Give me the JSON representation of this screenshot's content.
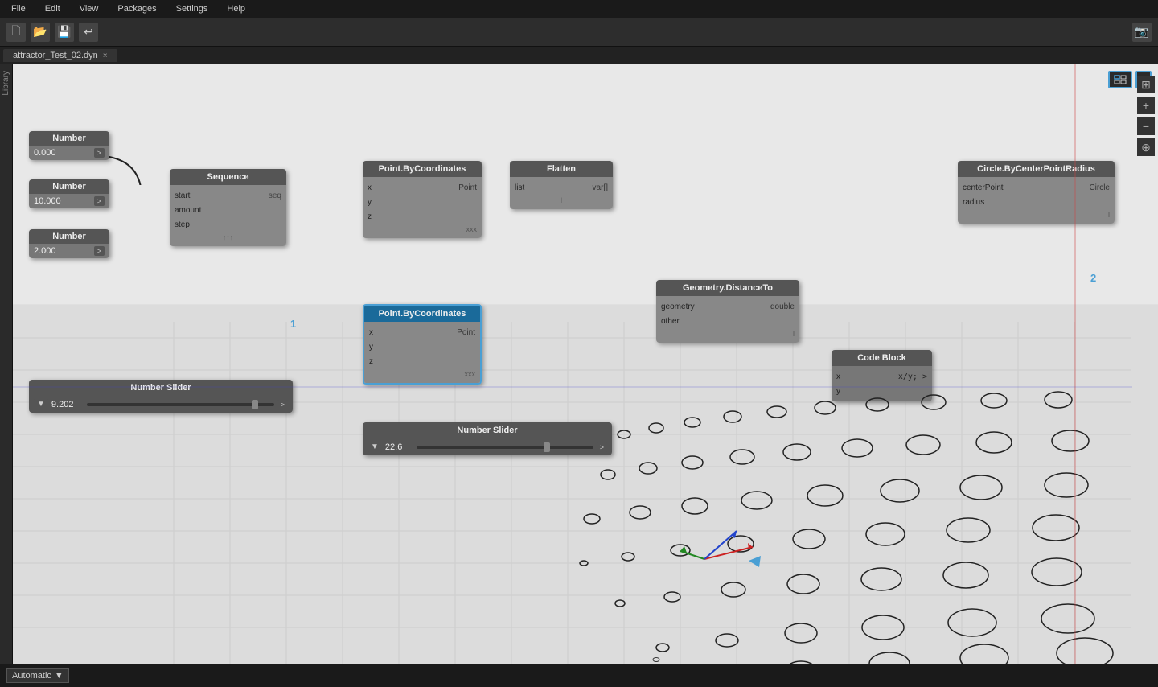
{
  "titlebar": {
    "menus": [
      "File",
      "Edit",
      "View",
      "Packages",
      "Settings",
      "Help"
    ]
  },
  "tab": {
    "name": "attractor_Test_02.dyn",
    "close": "×"
  },
  "sidebar": {
    "label": "Library"
  },
  "nodes": {
    "number1": {
      "title": "Number",
      "value": "0.000",
      "btn": ">"
    },
    "number2": {
      "title": "Number",
      "value": "10.000",
      "btn": ">"
    },
    "number3": {
      "title": "Number",
      "value": "2.000",
      "btn": ">"
    },
    "sequence": {
      "title": "Sequence",
      "inputs": [
        "start",
        "amount",
        "step"
      ],
      "output": "seq",
      "footer": "↑↑↑"
    },
    "pointByCoords1": {
      "title": "Point.ByCoordinates",
      "inputs": [
        "x",
        "y",
        "z"
      ],
      "output": "Point",
      "footer": "xxx"
    },
    "flatten": {
      "title": "Flatten",
      "inputs": [
        "list"
      ],
      "output": "var[]",
      "footer": "l"
    },
    "pointByCoords2": {
      "title": "Point.ByCoordinates",
      "inputs": [
        "x",
        "y",
        "z"
      ],
      "output": "Point",
      "footer": "xxx",
      "selected": true
    },
    "geometryDistanceTo": {
      "title": "Geometry.DistanceTo",
      "inputs": [
        "geometry",
        "other"
      ],
      "output": "double",
      "footer": "l"
    },
    "circleByCenter": {
      "title": "Circle.ByCenterPointRadius",
      "inputs": [
        "centerPoint",
        "radius"
      ],
      "output": "Circle",
      "footer": "l"
    },
    "codeBlock": {
      "title": "Code Block",
      "inputs": [
        "x",
        "y"
      ],
      "output": ">",
      "code": "x/y;"
    },
    "slider1": {
      "title": "Number Slider",
      "value": "9.202",
      "min": 0,
      "max": 10,
      "thumbPos": 0.92
    },
    "slider2": {
      "title": "Number Slider",
      "value": "22.6",
      "min": 0,
      "max": 30,
      "thumbPos": 0.75
    }
  },
  "status": {
    "mode": "Automatic",
    "dropdown_arrow": "▼"
  },
  "viewport": {
    "btn1": "⊞",
    "btn2": "≡"
  },
  "conn_labels": {
    "label1": "1",
    "label2": "2"
  }
}
